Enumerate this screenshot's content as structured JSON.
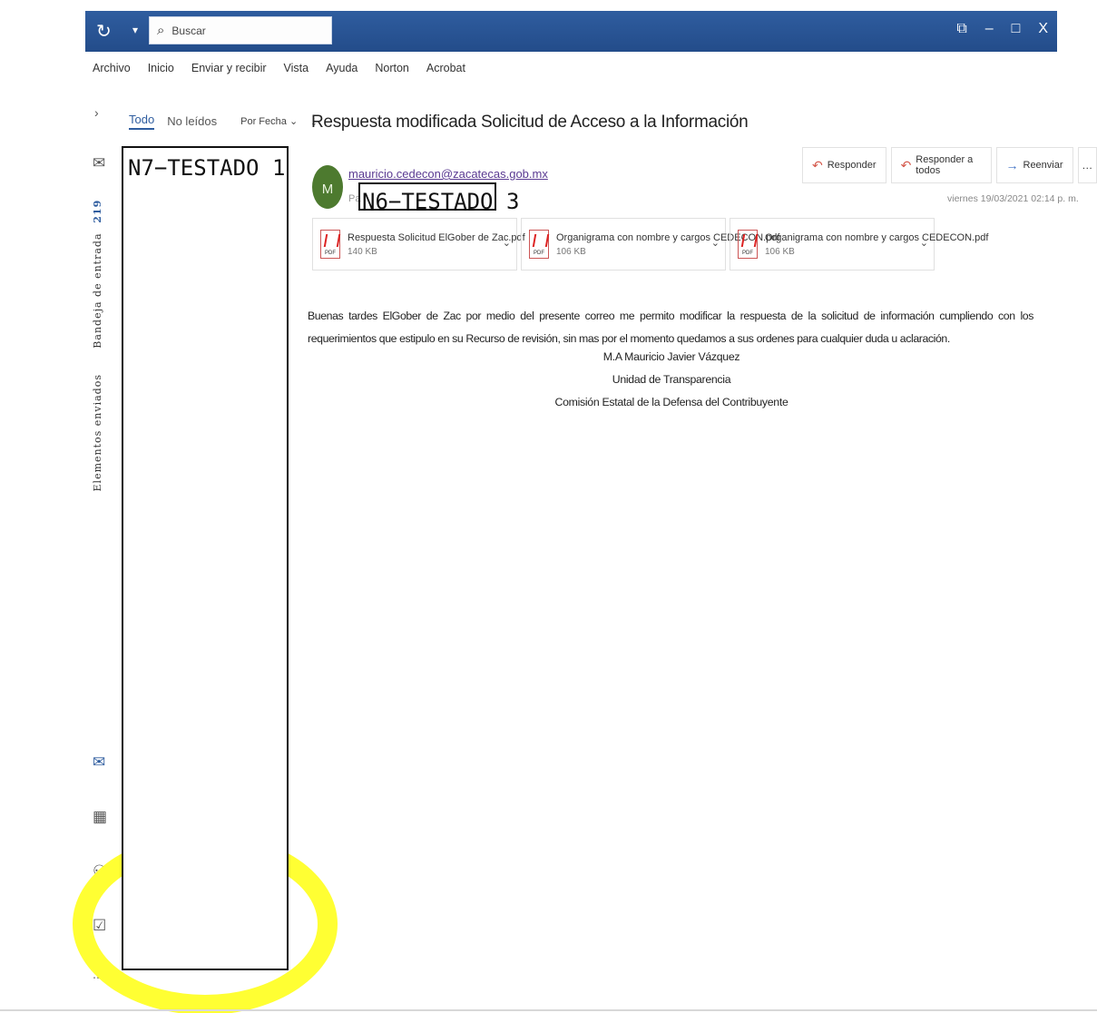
{
  "titlebar": {
    "search_placeholder": "Buscar",
    "refresh_icon": "refresh-icon",
    "controls": [
      "⧉",
      "–",
      "͡",
      "X"
    ]
  },
  "menu": [
    "Archivo",
    "Inicio",
    "Enviar y recibir",
    "Vista",
    "Ayuda",
    "Norton",
    "Acrobat"
  ],
  "rail": {
    "inbox_label": "Bandeja de entrada",
    "inbox_count": "219",
    "sent_label": "Elementos enviados"
  },
  "list": {
    "filter_all": "Todo",
    "filter_unread": "No leídos",
    "sort_label": "Por Fecha",
    "sort_arrow": "↓"
  },
  "redactions": {
    "list_label": "N7−TESTADO 1",
    "recipient_label": "N6−TESTADO 3"
  },
  "email": {
    "subject": "Respuesta modificada Solicitud de Acceso a la Información",
    "avatar_initial": "M",
    "sender": "mauricio.cedecon@zacatecas.gob.mx",
    "to_prefix": "Pa",
    "datetime": "viernes 19/03/2021 02:14 p. m.",
    "actions": {
      "reply": "Responder",
      "reply_all": "Responder a todos",
      "forward": "Reenviar",
      "more": "…"
    },
    "attachments": [
      {
        "name": "Respuesta Solicitud ElGober de Zac.pdf",
        "size": "140 KB"
      },
      {
        "name": "Organigrama con nombre y cargos CEDECON.pdf",
        "size": "106 KB"
      },
      {
        "name": "Organigrama con nombre y cargos CEDECON.pdf",
        "size": "106 KB"
      }
    ],
    "body": "Buenas tardes ElGober de Zac por medio del presente correo me permito modificar la respuesta de la solicitud de información cumpliendo con los requerimientos que estipulo en su Recurso de revisión, sin mas por el momento quedamos a sus ordenes para cualquier duda u aclaración.",
    "signature": [
      "M.A Mauricio Javier Vázquez",
      "Unidad de Transparencia",
      "Comisión Estatal de la Defensa del Contribuyente"
    ]
  },
  "colors": {
    "titlebar": "#2f5d9f",
    "highlight": "#ffff33",
    "avatar": "#4d7a2f",
    "sender_link": "#5a3a92"
  }
}
